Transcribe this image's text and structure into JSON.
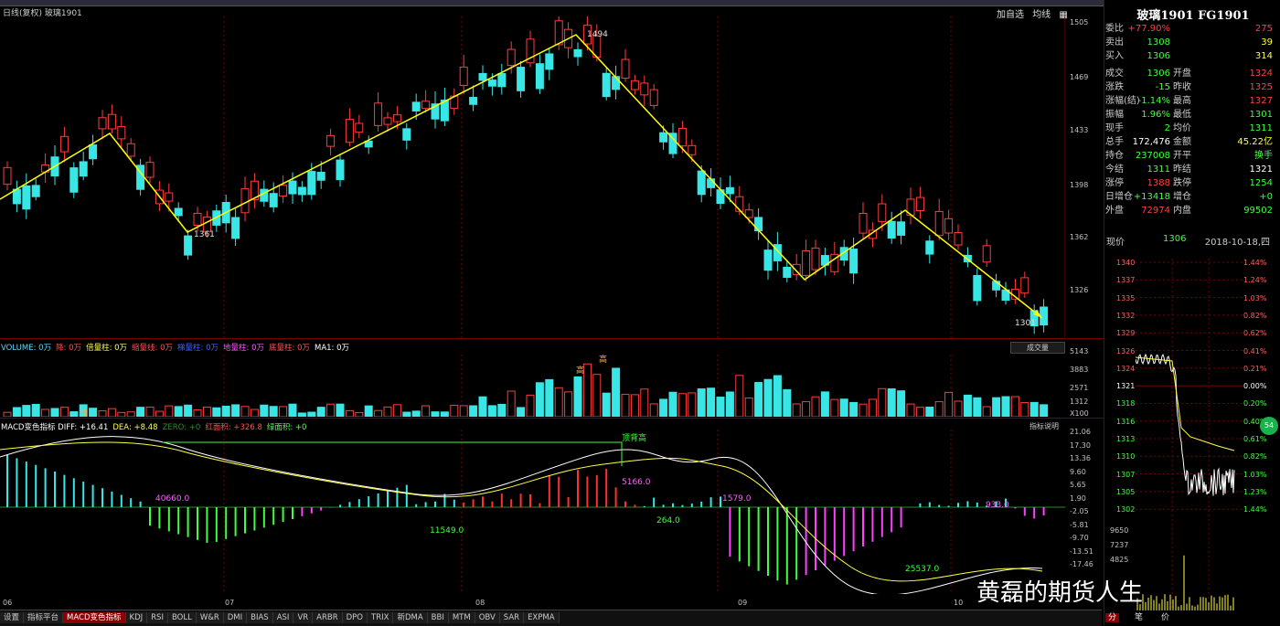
{
  "window": {
    "title": "日线(复权) 玻璃1901"
  },
  "toolbar": {
    "self_select": "加自选",
    "ma_label": "均线",
    "menu_icon": "menu-icon"
  },
  "main_axis": {
    "ticks": [
      "1505",
      "1469",
      "1433",
      "1398",
      "1362",
      "1326"
    ]
  },
  "annotations": {
    "high": "1494",
    "low1": "1361",
    "low2": "1301"
  },
  "colors": {
    "up": "#ff3c3c",
    "down": "#38e6e6",
    "zigzag": "#ffff00",
    "grid": "#7a0000"
  },
  "volume": {
    "legend": [
      {
        "text": "VOLUME: 0万",
        "color": "#5ad7ff"
      },
      {
        "text": "降: 0万",
        "color": "#ff5050"
      },
      {
        "text": "倍量柱: 0万",
        "color": "#ffff50"
      },
      {
        "text": "缩量线: 0万",
        "color": "#ff5050"
      },
      {
        "text": "梯量柱: 0万",
        "color": "#4060ff"
      },
      {
        "text": "地量柱: 0万",
        "color": "#ff50ff"
      },
      {
        "text": "底量柱: 0万",
        "color": "#ff5050"
      },
      {
        "text": "MA1: 0万",
        "color": "#ffffff"
      }
    ],
    "button": "成交量",
    "ticks": [
      "5143",
      "3883",
      "2571",
      "1312",
      "X100"
    ],
    "marks": {
      "high": "高",
      "double": "倍"
    }
  },
  "macd": {
    "legend": [
      {
        "text": "MACD变色指标 DIFF: +16.41",
        "color": "#ffffff"
      },
      {
        "text": "DEA: +8.48",
        "color": "#ffff50"
      },
      {
        "text": "ZERO: +0",
        "color": "#2a8a2a"
      },
      {
        "text": "红面积: +326.8",
        "color": "#ff5050"
      },
      {
        "text": "绿面积: +0",
        "color": "#50ff50"
      }
    ],
    "help": "指标说明",
    "ticks": [
      "21.06",
      "17.30",
      "13.36",
      "9.60",
      "5.65",
      "1.90",
      "-2.05",
      "-5.81",
      "-9.70",
      "-13.51",
      "-17.46"
    ],
    "divergence_label": "顶背高",
    "areas": [
      "40660.0",
      "5166.0",
      "1579.0",
      "933.0",
      "11549.0",
      "264.0",
      "25537.0"
    ]
  },
  "date_axis": [
    "06",
    "07",
    "08",
    "09",
    "10"
  ],
  "tabs": [
    "设置",
    "指标平台",
    "MACD变色指标",
    "KDJ",
    "RSI",
    "BOLL",
    "W&R",
    "DMI",
    "BIAS",
    "ASI",
    "VR",
    "ARBR",
    "DPO",
    "TRIX",
    "新DMA",
    "BBI",
    "MTM",
    "OBV",
    "SAR",
    "EXPMA"
  ],
  "quote": {
    "title": "玻璃1901 FG1901",
    "rows": [
      {
        "l": "委比",
        "v": "+77.90%",
        "vc": "#ff4040",
        "l2": "",
        "v2": "275",
        "v2c": "#ff4040"
      },
      {
        "l": "卖出",
        "v": "1308",
        "vc": "#40ff40",
        "l2": "",
        "v2": "39",
        "v2c": "#ffff40"
      },
      {
        "l": "买入",
        "v": "1306",
        "vc": "#40ff40",
        "l2": "",
        "v2": "314",
        "v2c": "#ffff40"
      },
      {
        "l": "成交",
        "v": "1306",
        "vc": "#40ff40",
        "l2": "开盘",
        "v2": "1324",
        "v2c": "#ff4040"
      },
      {
        "l": "涨跌",
        "v": "-15",
        "vc": "#40ff40",
        "l2": "昨收",
        "v2": "1325",
        "v2c": "#ff4040"
      },
      {
        "l": "涨幅(结)",
        "v": "-1.14%",
        "vc": "#40ff40",
        "l2": "最高",
        "v2": "1327",
        "v2c": "#ff4040"
      },
      {
        "l": "振幅",
        "v": "1.96%",
        "vc": "#40ff40",
        "l2": "最低",
        "v2": "1301",
        "v2c": "#40ff40"
      },
      {
        "l": "现手",
        "v": "2",
        "vc": "#40ff40",
        "l2": "均价",
        "v2": "1311",
        "v2c": "#40ff40"
      },
      {
        "l": "总手",
        "v": "172,476",
        "vc": "#ffffff",
        "l2": "金额",
        "v2": "45.22亿",
        "v2c": "#ffff40"
      },
      {
        "l": "持仓",
        "v": "237008",
        "vc": "#40ff40",
        "l2": "开平",
        "v2": "换手",
        "v2c": "#40ff40"
      },
      {
        "l": "今结",
        "v": "1311",
        "vc": "#40ff40",
        "l2": "昨结",
        "v2": "1321",
        "v2c": "#ffffff"
      },
      {
        "l": "涨停",
        "v": "1388",
        "vc": "#ff4040",
        "l2": "跌停",
        "v2": "1254",
        "v2c": "#40ff40"
      },
      {
        "l": "日增仓",
        "v": "+13418",
        "vc": "#40ff40",
        "l2": "增仓",
        "v2": "+0",
        "v2c": "#40ff40"
      },
      {
        "l": "外盘",
        "v": "72974",
        "vc": "#ff4040",
        "l2": "内盘",
        "v2": "99502",
        "v2c": "#40ff40"
      }
    ],
    "now_label": "现价",
    "now_value": "1306",
    "date": "2018-10-18,四"
  },
  "intraday": {
    "price_ticks": [
      "1340",
      "1337",
      "1335",
      "1332",
      "1329",
      "1326",
      "1324",
      "1321",
      "1318",
      "1316",
      "1313",
      "1310",
      "1307",
      "1305",
      "1302"
    ],
    "pct_ticks": [
      "1.44%",
      "1.24%",
      "1.03%",
      "0.82%",
      "0.62%",
      "0.41%",
      "0.21%",
      "0.00%",
      "0.20%",
      "0.40%",
      "0.61%",
      "0.82%",
      "1.03%",
      "1.23%",
      "1.44%"
    ],
    "vol_ticks": [
      "9650",
      "7237",
      "4825"
    ],
    "badge": "54",
    "tabs": [
      "分",
      "笔",
      "价"
    ]
  },
  "watermark": "黄磊的期货人生"
}
